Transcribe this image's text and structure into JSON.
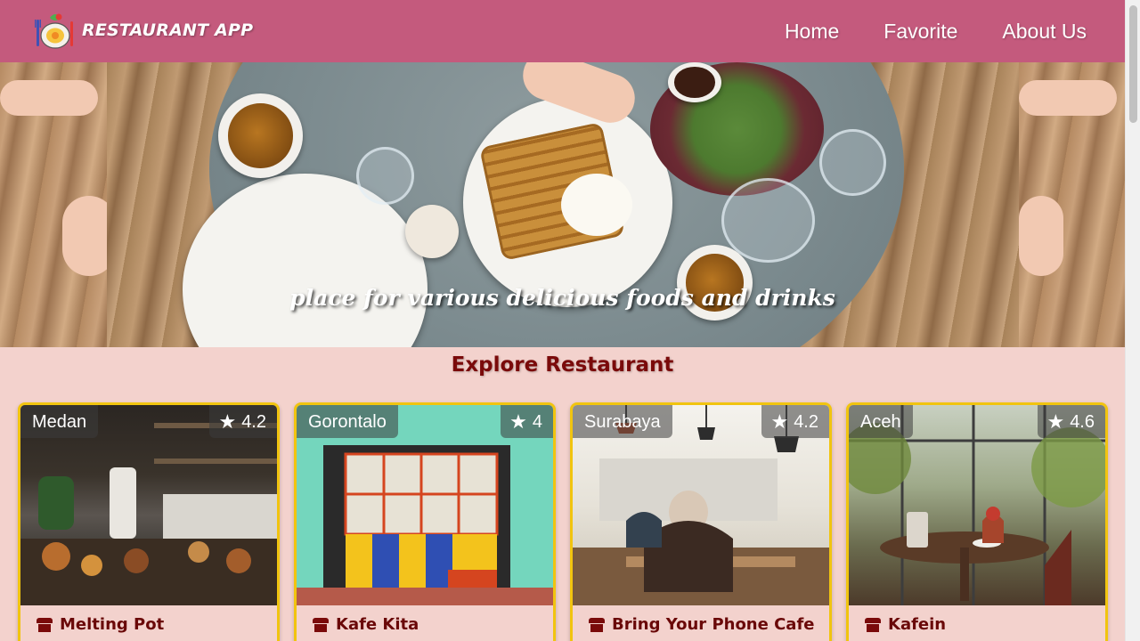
{
  "app": {
    "brand": "RESTAURANT APP",
    "logo_icon": "food-plate-logo-icon"
  },
  "nav": {
    "items": [
      {
        "label": "Home"
      },
      {
        "label": "Favorite"
      },
      {
        "label": "About Us"
      }
    ]
  },
  "hero": {
    "tagline": "place for various delicious foods and drinks"
  },
  "main": {
    "title": "Explore Restaurant",
    "restaurants": [
      {
        "city": "Medan",
        "rating": "4.2",
        "name": "Melting Pot"
      },
      {
        "city": "Gorontalo",
        "rating": "4",
        "name": "Kafe Kita"
      },
      {
        "city": "Surabaya",
        "rating": "4.2",
        "name": "Bring Your Phone Cafe"
      },
      {
        "city": "Aceh",
        "rating": "4.6",
        "name": "Kafein"
      }
    ]
  },
  "colors": {
    "header_bg": "#c45a7d",
    "page_bg": "#f3d2cd",
    "card_border": "#f1c40f",
    "title_color": "#7a0a0a"
  }
}
